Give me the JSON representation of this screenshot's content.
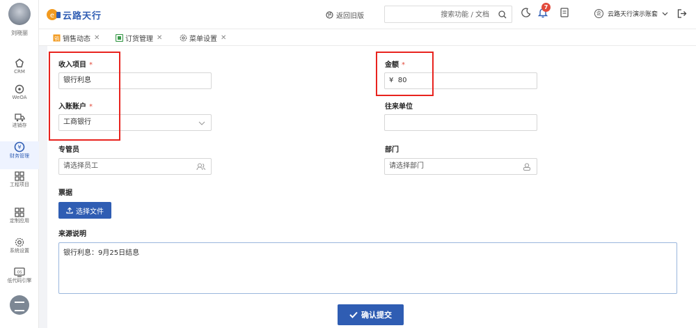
{
  "user": {
    "name": "刘晓丽"
  },
  "sidebar": {
    "items": [
      {
        "label": "CRM",
        "icon": "crm-icon"
      },
      {
        "label": "WeOA",
        "icon": "weoa-icon"
      },
      {
        "label": "进销存",
        "icon": "truck-icon"
      },
      {
        "label": "财务管理",
        "icon": "finance-icon",
        "active": true
      },
      {
        "label": "工程项目",
        "icon": "grid-icon"
      },
      {
        "label": "定制应用",
        "icon": "grid-icon"
      },
      {
        "label": "系统设置",
        "icon": "gear-icon"
      },
      {
        "label": "低代码引擎",
        "icon": "lowcode-icon"
      }
    ]
  },
  "header": {
    "logo_text": "云路天行",
    "back_label": "返回旧版",
    "search_placeholder": "搜索功能 / 文档",
    "notification_count": "7",
    "account_badge": "企",
    "account_name": "云路天行演示账套"
  },
  "tabs": [
    {
      "label": "销售动态"
    },
    {
      "label": "订货管理"
    },
    {
      "label": "菜单设置"
    }
  ],
  "form": {
    "income_item": {
      "label": "收入项目",
      "required": "*",
      "value": "银行利息"
    },
    "amount": {
      "label": "金额",
      "required": "*",
      "currency": "¥",
      "value": "80"
    },
    "account": {
      "label": "入账账户",
      "required": "*",
      "value": "工商银行"
    },
    "counterparty": {
      "label": "往来单位",
      "value": ""
    },
    "manager": {
      "label": "专管员",
      "placeholder": "请选择员工"
    },
    "department": {
      "label": "部门",
      "placeholder": "请选择部门"
    },
    "receipt": {
      "label": "票据",
      "button_label": "选择文件"
    },
    "source_note": {
      "label": "来源说明",
      "value": "银行利息：9月25日结息"
    },
    "submit_label": "确认提交"
  },
  "colors": {
    "primary": "#2f5db3",
    "highlight": "#e8231e",
    "required": "#e24a3b"
  }
}
